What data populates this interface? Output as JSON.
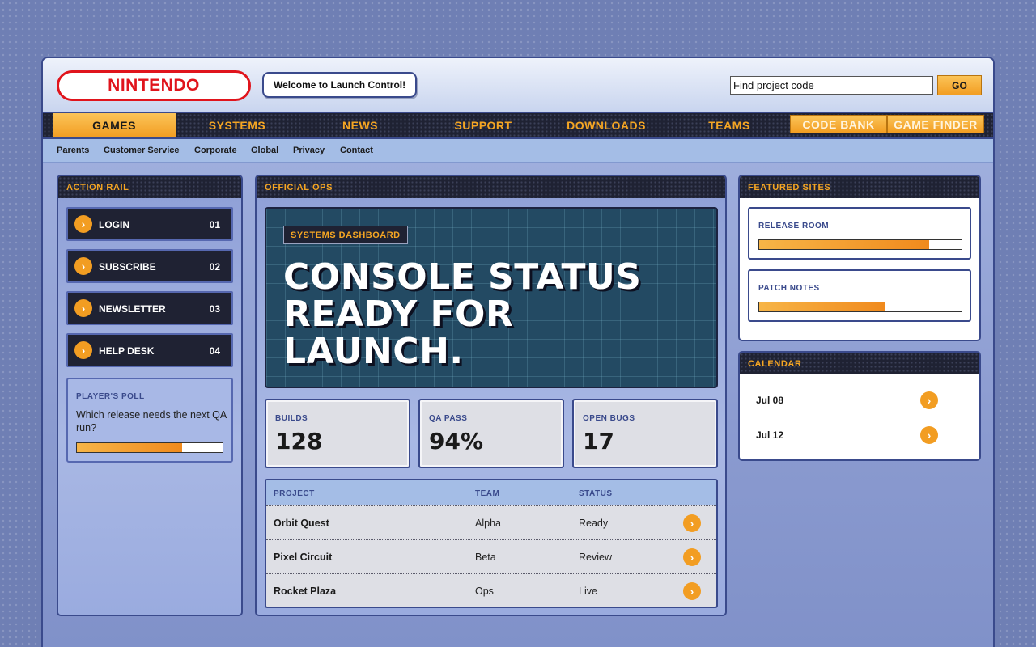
{
  "header": {
    "logo": "NINTENDO",
    "welcome": "Welcome to Launch Control!",
    "search_value": "Find project code",
    "go_label": "GO"
  },
  "nav": {
    "items": [
      "GAMES",
      "SYSTEMS",
      "NEWS",
      "SUPPORT",
      "DOWNLOADS",
      "TEAMS"
    ],
    "active": "GAMES",
    "pills": [
      "CODE BANK",
      "GAME FINDER"
    ]
  },
  "subnav": [
    "Parents",
    "Customer Service",
    "Corporate",
    "Global",
    "Privacy",
    "Contact"
  ],
  "action_rail": {
    "title": "ACTION RAIL",
    "buttons": [
      {
        "label": "LOGIN",
        "num": "01"
      },
      {
        "label": "SUBSCRIBE",
        "num": "02"
      },
      {
        "label": "NEWSLETTER",
        "num": "03"
      },
      {
        "label": "HELP DESK",
        "num": "04"
      }
    ],
    "poll": {
      "title": "PLAYER'S POLL",
      "question": "Which release needs the next QA run?",
      "progress": 0.72
    }
  },
  "official_ops": {
    "title": "OFFICIAL OPS",
    "hero": {
      "badge": "SYSTEMS DASHBOARD",
      "headline": "CONSOLE STATUS READY FOR LAUNCH."
    },
    "stats": [
      {
        "label": "BUILDS",
        "value": "128"
      },
      {
        "label": "QA PASS",
        "value": "94%"
      },
      {
        "label": "OPEN BUGS",
        "value": "17"
      }
    ],
    "table": {
      "headers": [
        "PROJECT",
        "TEAM",
        "STATUS"
      ],
      "rows": [
        {
          "project": "Orbit Quest",
          "team": "Alpha",
          "status": "Ready"
        },
        {
          "project": "Pixel Circuit",
          "team": "Beta",
          "status": "Review"
        },
        {
          "project": "Rocket Plaza",
          "team": "Ops",
          "status": "Live"
        }
      ]
    }
  },
  "featured_sites": {
    "title": "FEATURED SITES",
    "cards": [
      {
        "label": "RELEASE ROOM",
        "progress": 0.84
      },
      {
        "label": "PATCH NOTES",
        "progress": 0.62
      }
    ]
  },
  "calendar": {
    "title": "CALENDAR",
    "dates": [
      "Jul 08",
      "Jul 12"
    ]
  },
  "colors": {
    "accent": "#f29d22",
    "brand_red": "#e0141c",
    "navy": "#1f2233",
    "border": "#3a4a8c"
  },
  "icons": {
    "row_action": "chevron-right-icon"
  }
}
